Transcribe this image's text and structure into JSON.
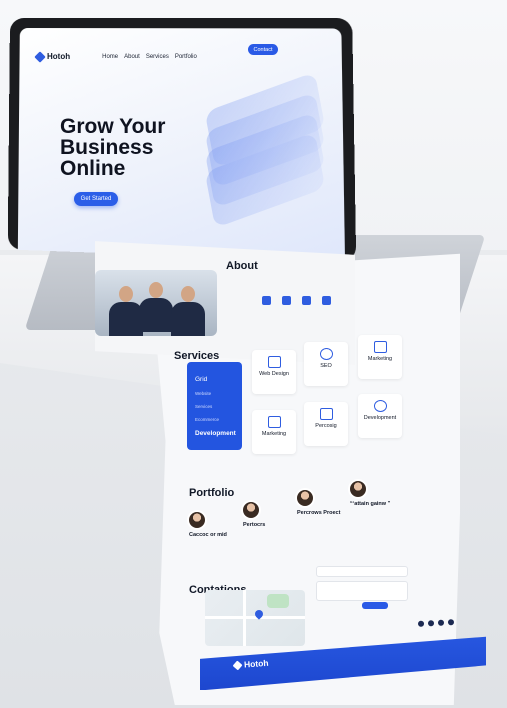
{
  "brand": "Hotoh",
  "nav": {
    "links": [
      "Home",
      "About",
      "Services",
      "Portfolio"
    ],
    "contact": "Contact"
  },
  "hero": {
    "title": "Grow Your Business Online",
    "cta": "Get Started"
  },
  "about": {
    "title": "About"
  },
  "services": {
    "title": "Services",
    "menu": [
      "Grid",
      "Website",
      "Services",
      "Ecommerce",
      "Development"
    ],
    "cards": [
      "Web Design",
      "SEO",
      "Marketing",
      "Marketing",
      "Percosig",
      "Development"
    ]
  },
  "portfolio": {
    "title": "Portfolio",
    "items": [
      "Caccoc or mid",
      "Pertocrs",
      "Percrows Proect",
      "“ʻattain gainw ”"
    ]
  },
  "contact": {
    "title": "Contations"
  },
  "footer": {
    "brand": "Hotoh"
  },
  "colors": {
    "accent": "#2a5ae6",
    "text": "#111827"
  }
}
